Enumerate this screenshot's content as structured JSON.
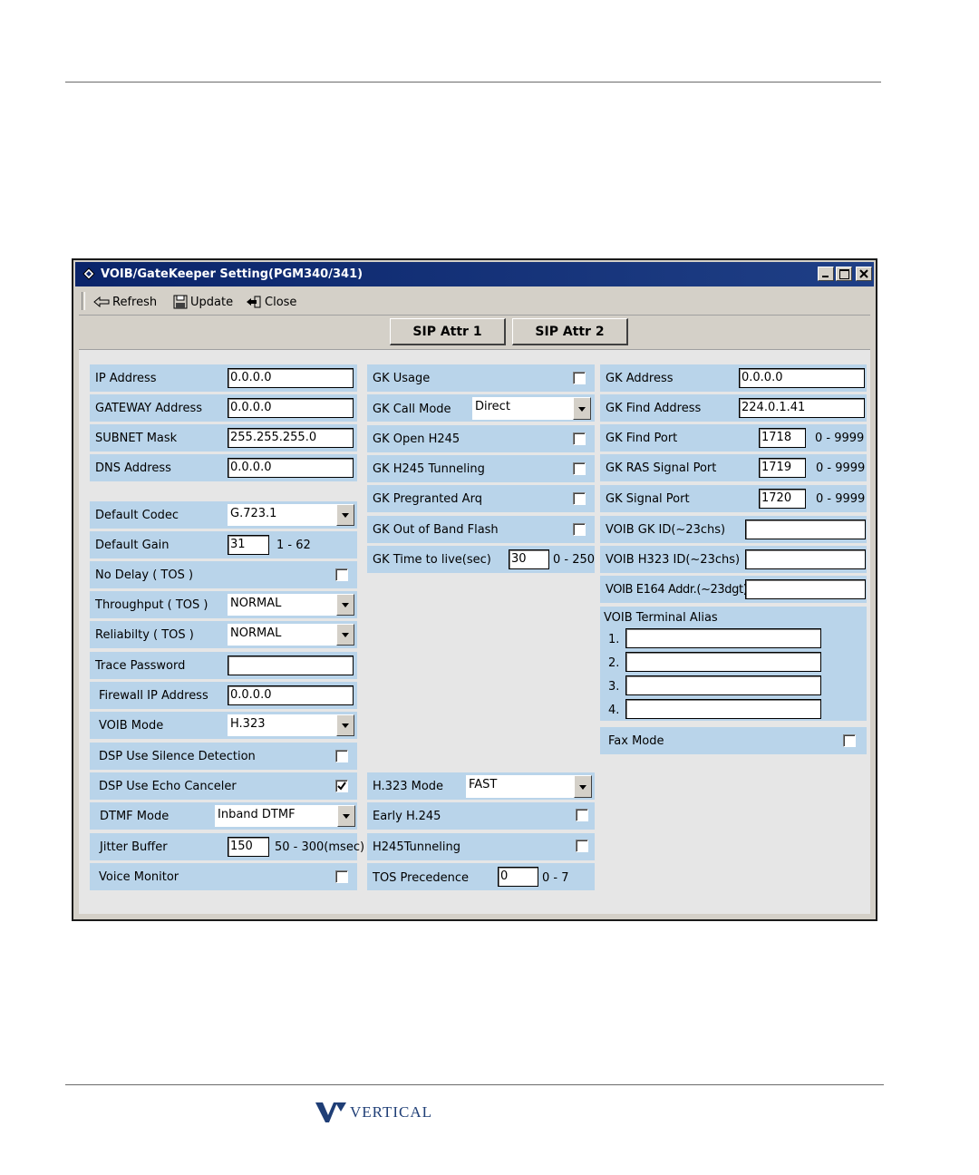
{
  "window": {
    "title": "VOIB/GateKeeper Setting(PGM340/341)",
    "controls": [
      "minimize-icon",
      "maximize-icon",
      "close-icon"
    ]
  },
  "toolbar": {
    "refresh": "Refresh",
    "update": "Update",
    "close": "Close"
  },
  "tabs": [
    "SIP Attr 1",
    "SIP Attr 2"
  ],
  "left": {
    "ip_address": {
      "label": "IP Address",
      "value": "0.0.0.0"
    },
    "gateway_address": {
      "label": "GATEWAY Address",
      "value": "0.0.0.0"
    },
    "subnet_mask": {
      "label": "SUBNET Mask",
      "value": "255.255.255.0"
    },
    "dns_address": {
      "label": "DNS Address",
      "value": "0.0.0.0"
    },
    "default_codec": {
      "label": "Default Codec",
      "value": "G.723.1"
    },
    "default_gain": {
      "label": "Default Gain",
      "value": "31",
      "range": "1 - 62"
    },
    "no_delay": {
      "label": "No Delay ( TOS )",
      "checked": false
    },
    "throughput": {
      "label": "Throughput ( TOS )",
      "value": "NORMAL"
    },
    "reliability": {
      "label": "Reliabilty ( TOS )",
      "value": "NORMAL"
    },
    "trace_password": {
      "label": "Trace Password",
      "value": ""
    },
    "firewall_ip": {
      "label": "Firewall IP Address",
      "value": "0.0.0.0"
    },
    "voib_mode": {
      "label": "VOIB Mode",
      "value": "H.323"
    },
    "dsp_silence": {
      "label": "DSP Use Silence Detection",
      "checked": false
    },
    "dsp_echo": {
      "label": "DSP Use Echo Canceler",
      "checked": true
    },
    "dtmf_mode": {
      "label": "DTMF Mode",
      "value": "Inband DTMF"
    },
    "jitter_buffer": {
      "label": "Jitter Buffer",
      "value": "150",
      "range": "50 - 300(msec)"
    },
    "voice_monitor": {
      "label": "Voice Monitor",
      "checked": false
    }
  },
  "middle": {
    "gk_usage": {
      "label": "GK Usage",
      "checked": false
    },
    "gk_call_mode": {
      "label": "GK Call Mode",
      "value": "Direct"
    },
    "gk_open_h245": {
      "label": "GK Open H245",
      "checked": false
    },
    "gk_h245_tunneling": {
      "label": "GK H245 Tunneling",
      "checked": false
    },
    "gk_pregranted_arq": {
      "label": "GK Pregranted Arq",
      "checked": false
    },
    "gk_out_of_band_flash": {
      "label": "GK Out of Band Flash",
      "checked": false
    },
    "gk_time_to_live": {
      "label": "GK Time to live(sec)",
      "value": "30",
      "range": "0 - 250"
    },
    "h323_mode": {
      "label": "H.323 Mode",
      "value": "FAST"
    },
    "early_h245": {
      "label": "Early H.245",
      "checked": false
    },
    "h245_tunneling": {
      "label": "H245Tunneling",
      "checked": false
    },
    "tos_precedence": {
      "label": "TOS Precedence",
      "value": "0",
      "range": "0 - 7"
    }
  },
  "right": {
    "gk_address": {
      "label": "GK Address",
      "value": "0.0.0.0"
    },
    "gk_find_address": {
      "label": "GK Find Address",
      "value": "224.0.1.41"
    },
    "gk_find_port": {
      "label": "GK Find Port",
      "value": "1718",
      "range": "0 - 9999"
    },
    "gk_ras_signal_port": {
      "label": "GK RAS Signal Port",
      "value": "1719",
      "range": "0 - 9999"
    },
    "gk_signal_port": {
      "label": "GK Signal Port",
      "value": "1720",
      "range": "0 - 9999"
    },
    "voib_gk_id": {
      "label": "VOIB GK ID(~23chs)",
      "value": ""
    },
    "voib_h323_id": {
      "label": "VOIB H323 ID(~23chs)",
      "value": ""
    },
    "voib_e164": {
      "label": "VOIB E164 Addr.(~23dgt)",
      "value": ""
    },
    "terminal_alias": {
      "label": "VOIB Terminal Alias",
      "items": [
        {
          "num": "1.",
          "value": ""
        },
        {
          "num": "2.",
          "value": ""
        },
        {
          "num": "3.",
          "value": ""
        },
        {
          "num": "4.",
          "value": ""
        }
      ]
    },
    "fax_mode": {
      "label": "Fax Mode",
      "checked": false
    }
  },
  "footer": {
    "brand": "VERTICAL"
  },
  "colors": {
    "title_bar": "#0a246a",
    "panel_cell": "#b9d4ea",
    "brand": "#1f3e76"
  }
}
